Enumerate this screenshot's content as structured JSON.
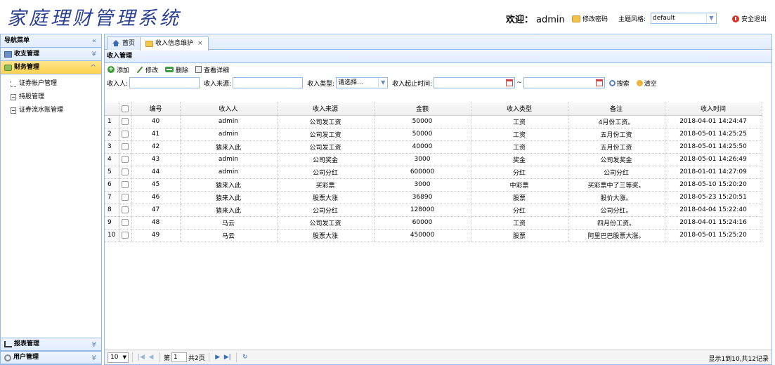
{
  "header": {
    "logo": "家庭理财管理系统",
    "welcome_label": "欢迎：",
    "username": "admin",
    "change_password": "修改密码",
    "theme_label": "主题风格:",
    "theme_value": "default",
    "logout": "安全退出"
  },
  "sidebar": {
    "title": "导航菜单",
    "sections": [
      {
        "label": "收支管理"
      },
      {
        "label": "财务管理"
      }
    ],
    "items": [
      {
        "label": "证券帐户管理"
      },
      {
        "label": "持股管理"
      },
      {
        "label": "证券流水账管理"
      }
    ],
    "bottom_sections": [
      {
        "label": "报表管理"
      },
      {
        "label": "用户管理"
      }
    ]
  },
  "tabs": [
    {
      "label": "首页"
    },
    {
      "label": "收入信息维护"
    }
  ],
  "content": {
    "title": "收入管理",
    "toolbar": {
      "add": "添加",
      "edit": "修改",
      "delete": "删除",
      "view": "查看详细"
    },
    "search": {
      "payer_label": "收入人:",
      "source_label": "收入来源:",
      "type_label": "收入类型:",
      "type_value": "请选择...",
      "time_label": "收入起止时间:",
      "tilde": "~",
      "search_btn": "搜索",
      "clear_btn": "清空"
    }
  },
  "table": {
    "columns": [
      "编号",
      "收入人",
      "收入来源",
      "金额",
      "收入类型",
      "备注",
      "收入时间"
    ],
    "rows": [
      [
        "1",
        "40",
        "admin",
        "公司发工资",
        "50000",
        "工资",
        "4月份工资。",
        "2018-04-01 14:24:47"
      ],
      [
        "2",
        "41",
        "admin",
        "公司发工资",
        "50000",
        "工资",
        "五月份工资",
        "2018-05-01 14:25:25"
      ],
      [
        "3",
        "42",
        "猿来入此",
        "公司发工资",
        "40000",
        "工资",
        "五月份工资",
        "2018-05-01 14:25:50"
      ],
      [
        "4",
        "43",
        "admin",
        "公司奖金",
        "3000",
        "奖金",
        "公司发奖金",
        "2018-05-01 14:26:49"
      ],
      [
        "5",
        "44",
        "admin",
        "公司分红",
        "600000",
        "分红",
        "公司分红",
        "2018-01-01 14:27:09"
      ],
      [
        "6",
        "45",
        "猿来入此",
        "买彩票",
        "3000",
        "中彩票",
        "买彩票中了三等奖。",
        "2018-05-10 15:20:20"
      ],
      [
        "7",
        "46",
        "猿来入此",
        "股票大涨",
        "36890",
        "股票",
        "股价大涨。",
        "2018-05-23 15:20:51"
      ],
      [
        "8",
        "47",
        "猿来入此",
        "公司分红",
        "128000",
        "分红",
        "公司分红。",
        "2018-04-04 15:22:40"
      ],
      [
        "9",
        "48",
        "马云",
        "公司发工资",
        "60000",
        "工资",
        "四月份工资。",
        "2018-04-01 15:24:16"
      ],
      [
        "10",
        "49",
        "马云",
        "股票大涨",
        "450000",
        "股票",
        "阿里巴巴股票大涨。",
        "2018-05-01 15:25:20"
      ]
    ]
  },
  "pager": {
    "page_size": "10",
    "page_prefix": "第",
    "page_number": "1",
    "total_pages": "共2页",
    "info": "显示1到10,共12记录"
  }
}
